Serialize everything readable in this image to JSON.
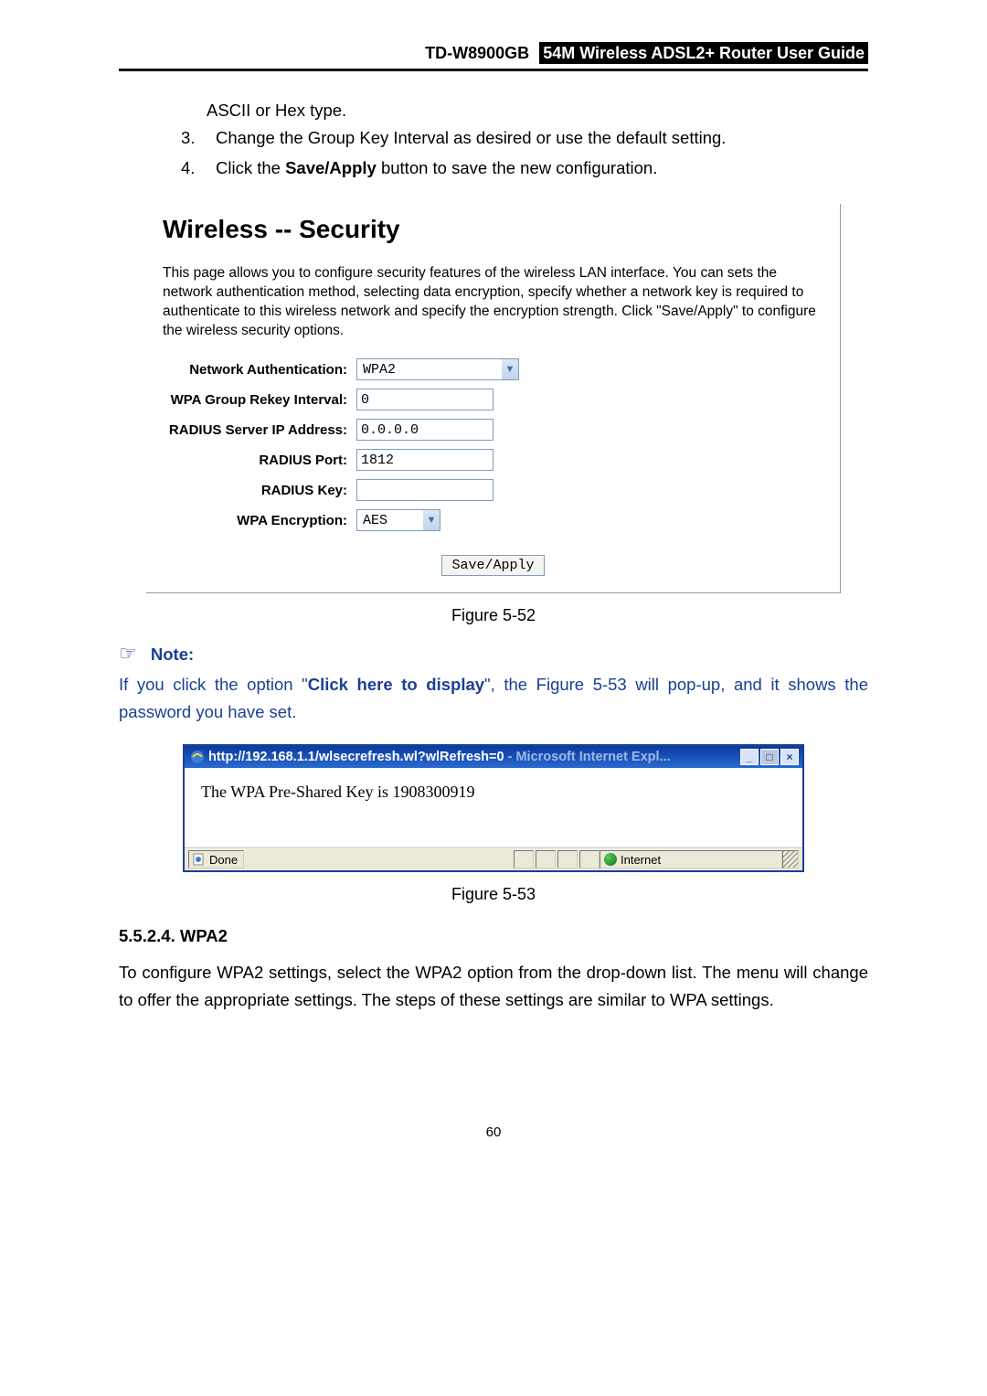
{
  "header": {
    "model": "TD-W8900GB",
    "guide": "54M  Wireless  ADSL2+  Router  User  Guide"
  },
  "intro": {
    "cont": "ASCII or Hex type.",
    "items": [
      {
        "num": "3.",
        "before": "Change the Group Key Interval as desired or use the default setting."
      },
      {
        "num": "4.",
        "before": "Click the ",
        "bold": "Save/Apply",
        "after": " button to save the new configuration."
      }
    ]
  },
  "wireless": {
    "title": "Wireless -- Security",
    "desc": "This page allows you to configure security features of the wireless LAN interface. You can sets the network authentication method, selecting data encryption, specify whether a network key is required to authenticate to this wireless network and specify the encryption strength. Click \"Save/Apply\" to configure the wireless security options.",
    "fields": {
      "netauth_label": "Network Authentication:",
      "netauth_value": "WPA2",
      "rekey_label": "WPA Group Rekey Interval:",
      "rekey_value": "0",
      "radiusip_label": "RADIUS Server IP Address:",
      "radiusip_value": "0.0.0.0",
      "radiusport_label": "RADIUS Port:",
      "radiusport_value": "1812",
      "radiuskey_label": "RADIUS Key:",
      "radiuskey_value": "",
      "wpaenc_label": "WPA Encryption:",
      "wpaenc_value": "AES"
    },
    "save_btn": "Save/Apply"
  },
  "fig52": "Figure 5-52",
  "note": {
    "label": "Note:",
    "body_before": "If you click the option \"",
    "body_bold": "Click here to display",
    "body_after": "\", the Figure 5-53 will pop-up, and it shows the password you have set."
  },
  "popup": {
    "url_white": "http://192.168.1.1/wlsecrefresh.wl?wlRefresh=0 ",
    "url_dim": "- Microsoft Internet Expl...",
    "body": "The WPA Pre-Shared Key is 1908300919",
    "status_done": "Done",
    "status_internet": "Internet"
  },
  "fig53": "Figure 5-53",
  "section": {
    "num": "5.5.2.4.   WPA2",
    "body": "To configure WPA2 settings, select the WPA2 option from the drop-down list. The menu will change to offer the appropriate settings. The steps of these settings are similar to WPA settings."
  },
  "page_num": "60"
}
